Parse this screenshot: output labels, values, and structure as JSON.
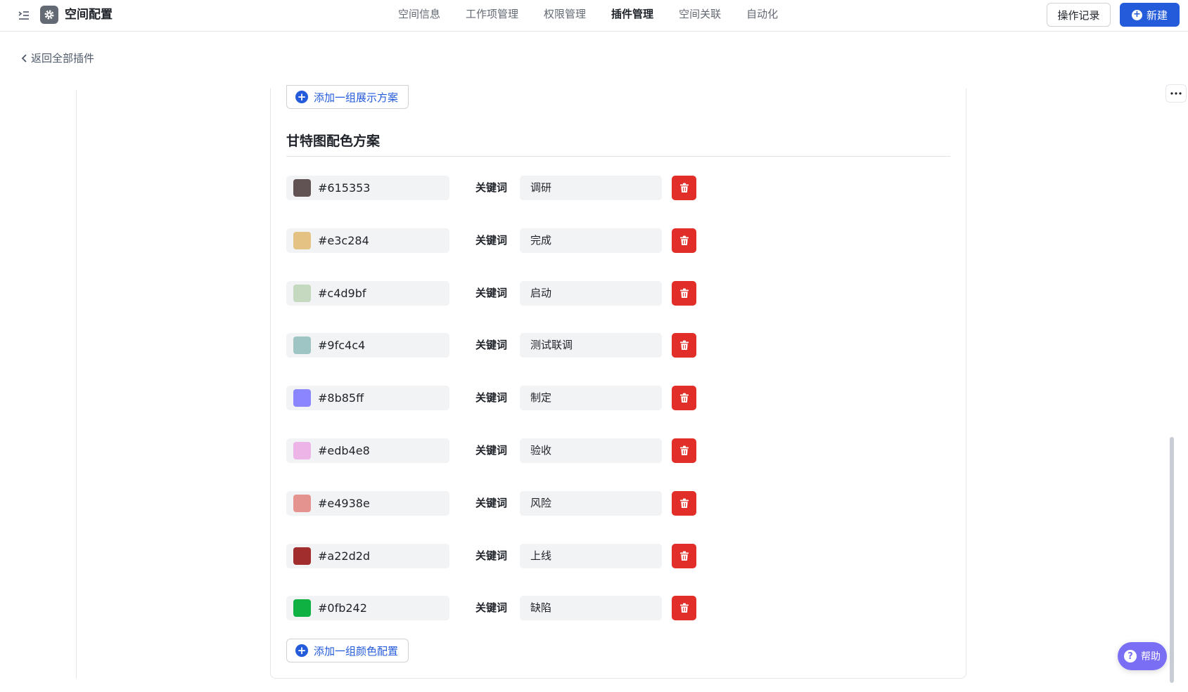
{
  "header": {
    "title": "空间配置",
    "tabs": [
      {
        "label": "空间信息",
        "active": false
      },
      {
        "label": "工作项管理",
        "active": false
      },
      {
        "label": "权限管理",
        "active": false
      },
      {
        "label": "插件管理",
        "active": true
      },
      {
        "label": "空间关联",
        "active": false
      },
      {
        "label": "自动化",
        "active": false
      }
    ],
    "log_button": "操作记录",
    "new_button": "新建"
  },
  "back_link": "返回全部插件",
  "display_scheme": {
    "add_button": "添加一组展示方案"
  },
  "gantt_colors": {
    "title": "甘特图配色方案",
    "keyword_label": "关键词",
    "rows": [
      {
        "color": "#615353",
        "keyword": "调研"
      },
      {
        "color": "#e3c284",
        "keyword": "完成"
      },
      {
        "color": "#c4d9bf",
        "keyword": "启动"
      },
      {
        "color": "#9fc4c4",
        "keyword": "测试联调"
      },
      {
        "color": "#8b85ff",
        "keyword": "制定"
      },
      {
        "color": "#edb4e8",
        "keyword": "验收"
      },
      {
        "color": "#e4938e",
        "keyword": "风险"
      },
      {
        "color": "#a22d2d",
        "keyword": "上线"
      },
      {
        "color": "#0fb242",
        "keyword": "缺陷"
      }
    ],
    "add_button": "添加一组颜色配置"
  },
  "help_button": "帮助",
  "theme": {
    "accent": "#245bdb",
    "danger": "#e22e28",
    "help": "#7a6ef5"
  }
}
